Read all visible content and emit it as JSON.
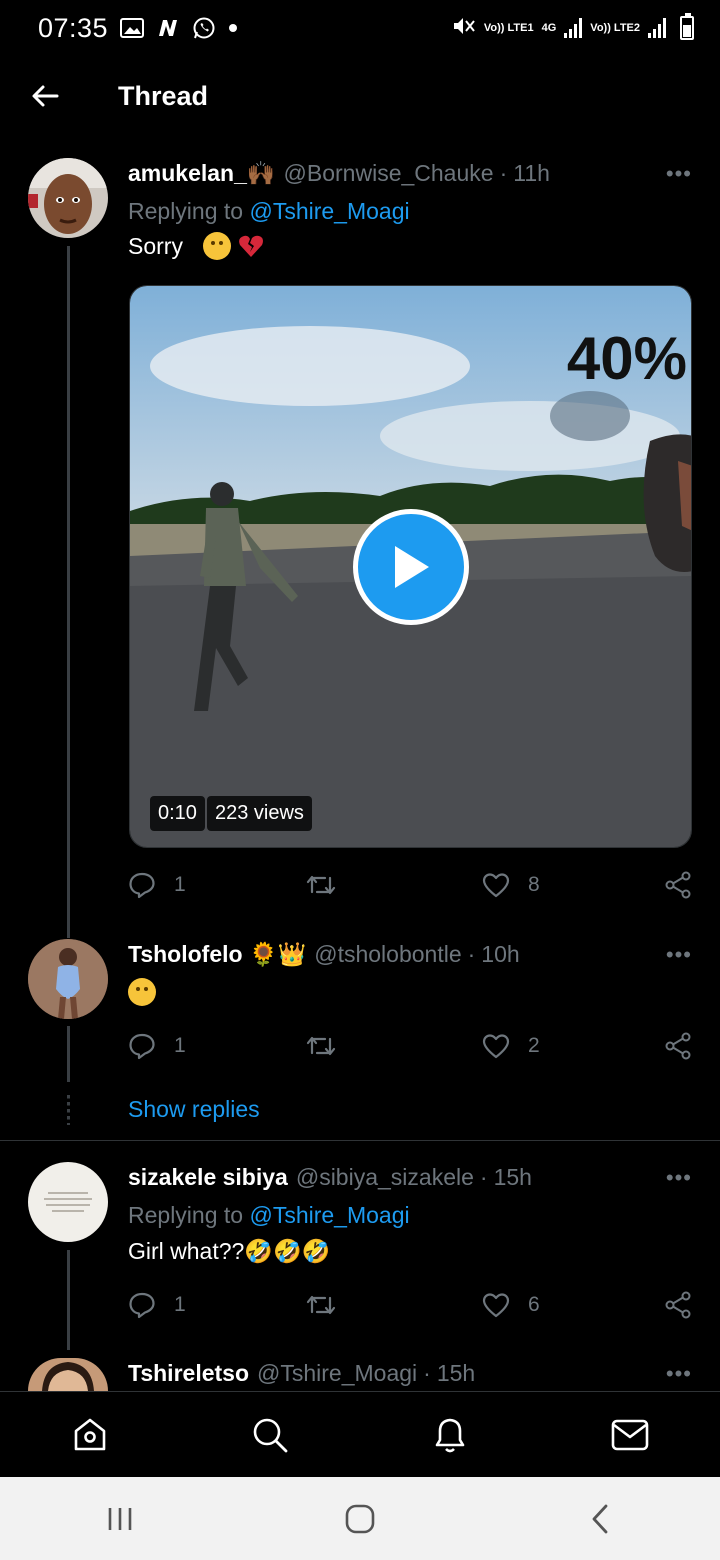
{
  "status_bar": {
    "time": "07:35",
    "net1": "Vo)) LTE1",
    "net_4g": "4G",
    "net2": "Vo)) LTE2",
    "left_icons": [
      "gallery-icon",
      "n-icon",
      "whatsapp-icon",
      "dot-icon"
    ]
  },
  "header": {
    "title": "Thread",
    "back_icon": "back-arrow-icon"
  },
  "tweets": [
    {
      "name": "amukelan_🙌🏾",
      "handle": "@Bornwise_Chauke",
      "time": "11h",
      "replying_label": "Replying to",
      "replying_handle": "@Tshire_Moagi",
      "text": "Sorry",
      "media": {
        "duration": "0:10",
        "views": "223 views",
        "overlay_text": "40%"
      },
      "replies": "1",
      "retweets": "",
      "likes": "8"
    },
    {
      "name": "Tsholofelo 🌻👑",
      "handle": "@tsholobontle",
      "time": "10h",
      "text": "",
      "replies": "1",
      "retweets": "",
      "likes": "2"
    },
    {
      "name": "sizakele sibiya",
      "handle": "@sibiya_sizakele",
      "time": "15h",
      "replying_label": "Replying to",
      "replying_handle": "@Tshire_Moagi",
      "text": "Girl what??🤣🤣🤣",
      "replies": "1",
      "retweets": "",
      "likes": "6"
    },
    {
      "name": "Tshireletso",
      "handle": "@Tshire_Moagi",
      "time": "15h"
    }
  ],
  "show_replies": "Show replies",
  "separator": "·",
  "more": "•••",
  "bottom_nav": [
    "home-icon",
    "search-icon",
    "notifications-icon",
    "messages-icon"
  ],
  "system_nav": [
    "recents-icon",
    "home-circle-icon",
    "back-chevron-icon"
  ],
  "colors": {
    "accent": "#1d9bf0",
    "muted": "#6e767d",
    "background": "#000000"
  }
}
